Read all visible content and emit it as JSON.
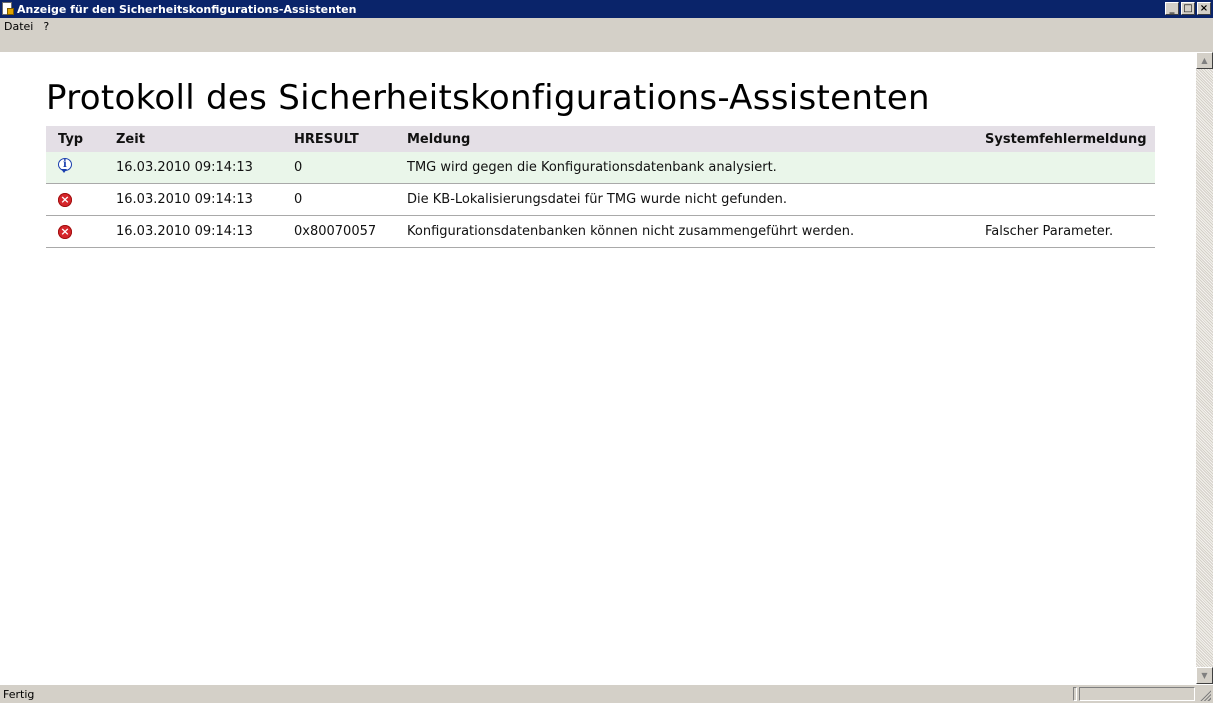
{
  "window": {
    "title": "Anzeige für den Sicherheitskonfigurations-Assistenten",
    "buttons": {
      "minimize": "_",
      "maximize": "□",
      "close": "×"
    }
  },
  "menu": {
    "items": [
      "Datei",
      "?"
    ]
  },
  "page": {
    "title": "Protokoll des Sicherheitskonfigurations-Assistenten"
  },
  "table": {
    "headers": [
      "Typ",
      "Zeit",
      "HRESULT",
      "Meldung",
      "Systemfehlermeldung"
    ],
    "rows": [
      {
        "type_icon": "info-icon",
        "zeit": "16.03.2010 09:14:13",
        "hresult": "0",
        "meldung": "TMG wird gegen die Konfigurationsdatenbank analysiert.",
        "systemfehler": ""
      },
      {
        "type_icon": "error-icon",
        "zeit": "16.03.2010 09:14:13",
        "hresult": "0",
        "meldung": "Die KB-Lokalisierungsdatei für TMG wurde nicht gefunden.",
        "systemfehler": ""
      },
      {
        "type_icon": "error-icon",
        "zeit": "16.03.2010 09:14:13",
        "hresult": "0x80070057",
        "meldung": "Konfigurationsdatenbanken können nicht zusammengeführt werden.",
        "systemfehler": "Falscher Parameter."
      }
    ]
  },
  "status": {
    "text": "Fertig"
  },
  "colors": {
    "titlebar": "#0a246a",
    "header_bg": "#e4dfe6",
    "highlight_row": "#eaf6ea",
    "error": "#d6262b",
    "info": "#1a3fae"
  }
}
